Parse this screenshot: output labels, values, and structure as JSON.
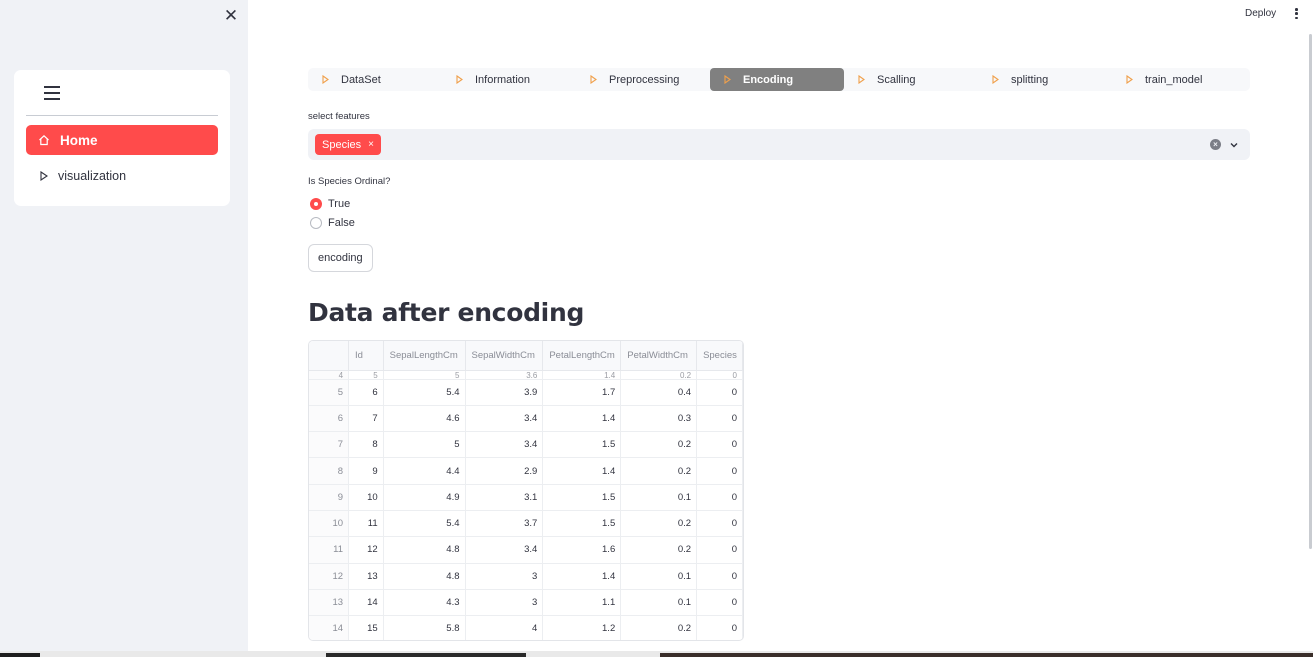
{
  "sidebar": {
    "close_label": "✕",
    "menu_icon": "hamburger-icon",
    "items": [
      {
        "label": "Home",
        "icon": "home-icon",
        "active": true
      },
      {
        "label": "visualization",
        "icon": "play-outline-icon",
        "active": false
      }
    ]
  },
  "header": {
    "deploy_label": "Deploy",
    "menu_icon": "kebab-menu-icon"
  },
  "tabs": [
    {
      "label": "DataSet",
      "active": false
    },
    {
      "label": "Information",
      "active": false
    },
    {
      "label": "Preprocessing",
      "active": false
    },
    {
      "label": "Encoding",
      "active": true
    },
    {
      "label": "Scalling",
      "active": false
    },
    {
      "label": "splitting",
      "active": false
    },
    {
      "label": "train_model",
      "active": false
    }
  ],
  "features": {
    "label": "select features",
    "selected": [
      "Species"
    ],
    "chip_remove": "×"
  },
  "ordinal": {
    "question": "Is Species Ordinal?",
    "options": [
      {
        "label": "True",
        "selected": true
      },
      {
        "label": "False",
        "selected": false
      }
    ]
  },
  "encode_button": "encoding",
  "section_title": "Data after encoding",
  "table": {
    "columns": [
      "",
      "Id",
      "SepalLengthCm",
      "SepalWidthCm",
      "PetalLengthCm",
      "PetalWidthCm",
      "Species"
    ],
    "partial_row": [
      "4",
      "5",
      "5",
      "3.6",
      "1.4",
      "0.2",
      "0"
    ],
    "rows": [
      [
        "5",
        "6",
        "5.4",
        "3.9",
        "1.7",
        "0.4",
        "0"
      ],
      [
        "6",
        "7",
        "4.6",
        "3.4",
        "1.4",
        "0.3",
        "0"
      ],
      [
        "7",
        "8",
        "5",
        "3.4",
        "1.5",
        "0.2",
        "0"
      ],
      [
        "8",
        "9",
        "4.4",
        "2.9",
        "1.4",
        "0.2",
        "0"
      ],
      [
        "9",
        "10",
        "4.9",
        "3.1",
        "1.5",
        "0.1",
        "0"
      ],
      [
        "10",
        "11",
        "5.4",
        "3.7",
        "1.5",
        "0.2",
        "0"
      ],
      [
        "11",
        "12",
        "4.8",
        "3.4",
        "1.6",
        "0.2",
        "0"
      ],
      [
        "12",
        "13",
        "4.8",
        "3",
        "1.4",
        "0.1",
        "0"
      ],
      [
        "13",
        "14",
        "4.3",
        "3",
        "1.1",
        "0.1",
        "0"
      ],
      [
        "14",
        "15",
        "5.8",
        "4",
        "1.2",
        "0.2",
        "0"
      ]
    ]
  },
  "colors": {
    "accent": "#ff4b4b",
    "sidebar_bg": "#f0f2f6",
    "active_tab": "#808080",
    "tab_icon": "#f0a04b"
  }
}
